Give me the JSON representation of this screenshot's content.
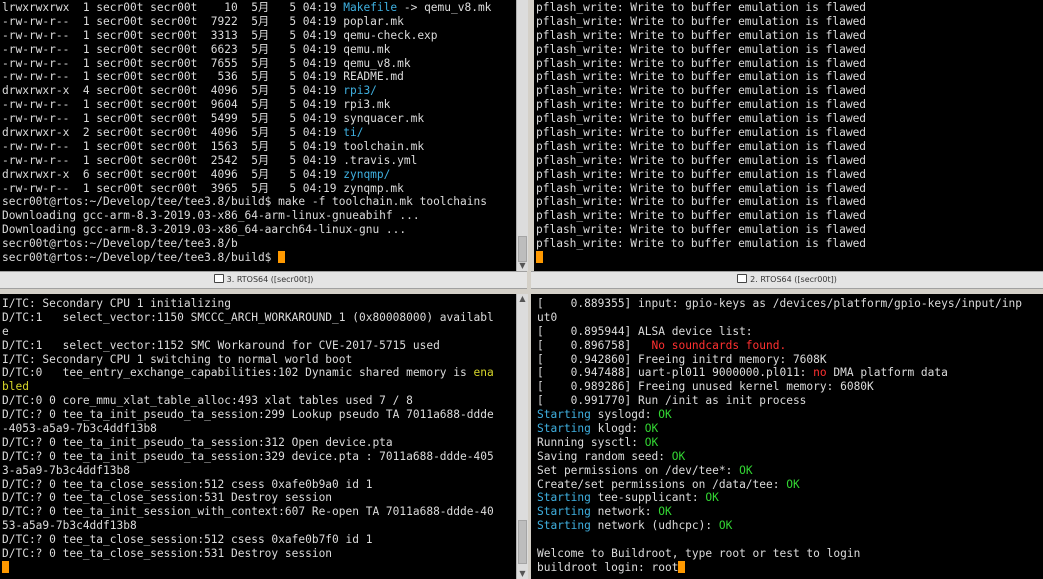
{
  "panes": {
    "top_left": {
      "tab_title": "3. RTOS64 ([secr00t])",
      "lines": [
        [
          {
            "t": "lrwxrwxrwx  1 secr00t secr00t    10  5月   5 04:19 "
          },
          {
            "t": "Makefile",
            "c": "dir"
          },
          {
            "t": " -> qemu_v8.mk"
          }
        ],
        [
          {
            "t": "-rw-rw-r--  1 secr00t secr00t  7922  5月   5 04:19 poplar.mk"
          }
        ],
        [
          {
            "t": "-rw-rw-r--  1 secr00t secr00t  3313  5月   5 04:19 qemu-check.exp"
          }
        ],
        [
          {
            "t": "-rw-rw-r--  1 secr00t secr00t  6623  5月   5 04:19 qemu.mk"
          }
        ],
        [
          {
            "t": "-rw-rw-r--  1 secr00t secr00t  7655  5月   5 04:19 qemu_v8.mk"
          }
        ],
        [
          {
            "t": "-rw-rw-r--  1 secr00t secr00t   536  5月   5 04:19 README.md"
          }
        ],
        [
          {
            "t": "drwxrwxr-x  4 secr00t secr00t  4096  5月   5 04:19 "
          },
          {
            "t": "rpi3/",
            "c": "dir"
          }
        ],
        [
          {
            "t": "-rw-rw-r--  1 secr00t secr00t  9604  5月   5 04:19 rpi3.mk"
          }
        ],
        [
          {
            "t": "-rw-rw-r--  1 secr00t secr00t  5499  5月   5 04:19 synquacer.mk"
          }
        ],
        [
          {
            "t": "drwxrwxr-x  2 secr00t secr00t  4096  5月   5 04:19 "
          },
          {
            "t": "ti/",
            "c": "dir"
          }
        ],
        [
          {
            "t": "-rw-rw-r--  1 secr00t secr00t  1563  5月   5 04:19 toolchain.mk"
          }
        ],
        [
          {
            "t": "-rw-rw-r--  1 secr00t secr00t  2542  5月   5 04:19 .travis.yml"
          }
        ],
        [
          {
            "t": "drwxrwxr-x  6 secr00t secr00t  4096  5月   5 04:19 "
          },
          {
            "t": "zynqmp/",
            "c": "dir"
          }
        ],
        [
          {
            "t": "-rw-rw-r--  1 secr00t secr00t  3965  5月   5 04:19 zynqmp.mk"
          }
        ],
        [
          {
            "t": "secr00t@rtos:~/Develop/tee/tee3.8/build$ make -f toolchain.mk toolchains"
          }
        ],
        [
          {
            "t": "Downloading gcc-arm-8.3-2019.03-x86_64-arm-linux-gnueabihf ..."
          }
        ],
        [
          {
            "t": "Downloading gcc-arm-8.3-2019.03-x86_64-aarch64-linux-gnu ..."
          }
        ],
        [
          {
            "t": "secr00t@rtos:~/Develop/tee/tee3.8/b"
          }
        ],
        [
          {
            "t": "secr00t@rtos:~/Develop/tee/tee3.8/build$ "
          },
          {
            "t": "",
            "cursor": true
          }
        ]
      ]
    },
    "top_right": {
      "tab_title": "2. RTOS64 ([secr00t])",
      "lines": [
        [
          {
            "t": "pflash_write: Write to buffer emulation is flawed"
          }
        ],
        [
          {
            "t": "pflash_write: Write to buffer emulation is flawed"
          }
        ],
        [
          {
            "t": "pflash_write: Write to buffer emulation is flawed"
          }
        ],
        [
          {
            "t": "pflash_write: Write to buffer emulation is flawed"
          }
        ],
        [
          {
            "t": "pflash_write: Write to buffer emulation is flawed"
          }
        ],
        [
          {
            "t": "pflash_write: Write to buffer emulation is flawed"
          }
        ],
        [
          {
            "t": "pflash_write: Write to buffer emulation is flawed"
          }
        ],
        [
          {
            "t": "pflash_write: Write to buffer emulation is flawed"
          }
        ],
        [
          {
            "t": "pflash_write: Write to buffer emulation is flawed"
          }
        ],
        [
          {
            "t": "pflash_write: Write to buffer emulation is flawed"
          }
        ],
        [
          {
            "t": "pflash_write: Write to buffer emulation is flawed"
          }
        ],
        [
          {
            "t": "pflash_write: Write to buffer emulation is flawed"
          }
        ],
        [
          {
            "t": "pflash_write: Write to buffer emulation is flawed"
          }
        ],
        [
          {
            "t": "pflash_write: Write to buffer emulation is flawed"
          }
        ],
        [
          {
            "t": "pflash_write: Write to buffer emulation is flawed"
          }
        ],
        [
          {
            "t": "pflash_write: Write to buffer emulation is flawed"
          }
        ],
        [
          {
            "t": "pflash_write: Write to buffer emulation is flawed"
          }
        ],
        [
          {
            "t": "pflash_write: Write to buffer emulation is flawed"
          }
        ],
        [
          {
            "t": "",
            "cursor": true
          }
        ]
      ]
    },
    "bottom_left": {
      "lines": [
        [
          {
            "t": "I/TC: Secondary CPU 1 initializing"
          }
        ],
        [
          {
            "t": "D/TC:1   select_vector:1150 SMCCC_ARCH_WORKAROUND_1 (0x80008000) availabl"
          }
        ],
        [
          {
            "t": "e"
          }
        ],
        [
          {
            "t": "D/TC:1   select_vector:1152 SMC Workaround for CVE-2017-5715 used"
          }
        ],
        [
          {
            "t": "I/TC: Secondary CPU 1 switching to normal world boot"
          }
        ],
        [
          {
            "t": "D/TC:0   tee_entry_exchange_capabilities:102 Dynamic shared memory is "
          },
          {
            "t": "ena",
            "c": "yellow"
          }
        ],
        [
          {
            "t": "bled",
            "c": "yellow"
          }
        ],
        [
          {
            "t": "D/TC:0 0 core_mmu_xlat_table_alloc:493 xlat tables used 7 / 8"
          }
        ],
        [
          {
            "t": "D/TC:? 0 tee_ta_init_pseudo_ta_session:299 Lookup pseudo TA 7011a688-ddde"
          }
        ],
        [
          {
            "t": "-4053-a5a9-7b3c4ddf13b8"
          }
        ],
        [
          {
            "t": "D/TC:? 0 tee_ta_init_pseudo_ta_session:312 Open device.pta"
          }
        ],
        [
          {
            "t": "D/TC:? 0 tee_ta_init_pseudo_ta_session:329 device.pta : 7011a688-ddde-405"
          }
        ],
        [
          {
            "t": "3-a5a9-7b3c4ddf13b8"
          }
        ],
        [
          {
            "t": "D/TC:? 0 tee_ta_close_session:512 csess 0xafe0b9a0 id 1"
          }
        ],
        [
          {
            "t": "D/TC:? 0 tee_ta_close_session:531 Destroy session"
          }
        ],
        [
          {
            "t": "D/TC:? 0 tee_ta_init_session_with_context:607 Re-open TA 7011a688-ddde-40"
          }
        ],
        [
          {
            "t": "53-a5a9-7b3c4ddf13b8"
          }
        ],
        [
          {
            "t": "D/TC:? 0 tee_ta_close_session:512 csess 0xafe0b7f0 id 1"
          }
        ],
        [
          {
            "t": "D/TC:? 0 tee_ta_close_session:531 Destroy session"
          }
        ],
        [
          {
            "t": "",
            "cursor": true
          }
        ]
      ]
    },
    "bottom_right": {
      "lines": [
        [
          {
            "t": "[    0.889355] input: gpio-keys as /devices/platform/gpio-keys/input/inp"
          }
        ],
        [
          {
            "t": "ut0"
          }
        ],
        [
          {
            "t": "[    0.895944] ALSA device list:"
          }
        ],
        [
          {
            "t": "[    0.896758]   "
          },
          {
            "t": "No soundcards found.",
            "c": "red"
          }
        ],
        [
          {
            "t": "[    0.942860] Freeing initrd memory: 7608K"
          }
        ],
        [
          {
            "t": "[    0.947488] uart-pl011 9000000.pl011: "
          },
          {
            "t": "no",
            "c": "red"
          },
          {
            "t": " DMA platform data"
          }
        ],
        [
          {
            "t": "[    0.989286] Freeing unused kernel memory: 6080K"
          }
        ],
        [
          {
            "t": "[    0.991770] Run /init as init process"
          }
        ],
        [
          {
            "t": "Starting",
            "c": "dir"
          },
          {
            "t": " syslogd: "
          },
          {
            "t": "OK",
            "c": "green"
          }
        ],
        [
          {
            "t": "Starting",
            "c": "dir"
          },
          {
            "t": " klogd: "
          },
          {
            "t": "OK",
            "c": "green"
          }
        ],
        [
          {
            "t": "Running sysctl: "
          },
          {
            "t": "OK",
            "c": "green"
          }
        ],
        [
          {
            "t": "Saving random seed: "
          },
          {
            "t": "OK",
            "c": "green"
          }
        ],
        [
          {
            "t": "Set permissions on /dev/tee*: "
          },
          {
            "t": "OK",
            "c": "green"
          }
        ],
        [
          {
            "t": "Create/set permissions on /data/tee: "
          },
          {
            "t": "OK",
            "c": "green"
          }
        ],
        [
          {
            "t": "Starting",
            "c": "dir"
          },
          {
            "t": " tee-supplicant: "
          },
          {
            "t": "OK",
            "c": "green"
          }
        ],
        [
          {
            "t": "Starting",
            "c": "dir"
          },
          {
            "t": " network: "
          },
          {
            "t": "OK",
            "c": "green"
          }
        ],
        [
          {
            "t": "Starting",
            "c": "dir"
          },
          {
            "t": " network (udhcpc): "
          },
          {
            "t": "OK",
            "c": "green"
          }
        ],
        [
          {
            "t": ""
          }
        ],
        [
          {
            "t": "Welcome to Buildroot, type root or test to login"
          }
        ],
        [
          {
            "t": "buildroot login: root"
          },
          {
            "t": "",
            "cursor": true
          }
        ]
      ]
    }
  }
}
